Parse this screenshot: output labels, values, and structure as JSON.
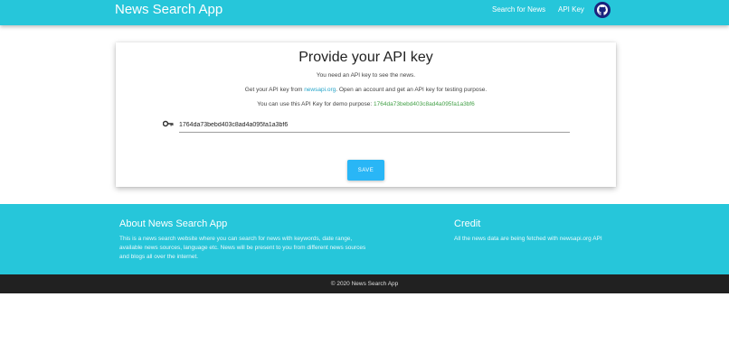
{
  "navbar": {
    "brand": "News Search App",
    "links": [
      "Search for News",
      "API Key"
    ],
    "github_icon": "github-icon"
  },
  "card": {
    "title": "Provide your API key",
    "line1": "You need an API key to see the news.",
    "line2_prefix": "Get your API key from ",
    "line2_link": "newsapi.org",
    "line2_suffix": ". Open an account and get an API key for testing purpose.",
    "line3_prefix": "You can use this API Key for demo purpose: ",
    "demo_key": "1764da73bebd403c8ad4a095fa1a3bf6",
    "input_value": "1764da73bebd403c8ad4a095fa1a3bf6",
    "key_icon": "key-icon",
    "save_label": "SAVE"
  },
  "footer": {
    "about_title": "About News Search App",
    "about_text": "This is a news search website where you can search for news with keywords, date range, available news sources, language etc. News will be present to you from different news sources and blogs all over the internet.",
    "credit_title": "Credit",
    "credit_text": "All the news data are being fetched with newsapi.org API",
    "copyright": "© 2020 News Search App"
  },
  "colors": {
    "primary": "#26c6da",
    "button": "#29b6f6",
    "link": "#26a5c9",
    "demo_key": "#43a047",
    "copyright_bg": "#212121",
    "github_bg": "#1a237e"
  }
}
